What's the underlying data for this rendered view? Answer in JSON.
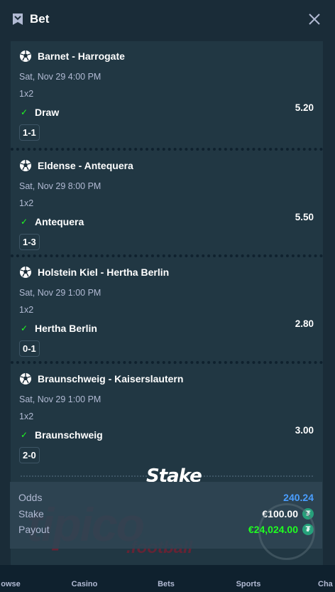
{
  "header": {
    "title": "Bet",
    "icon": "bet-slip-icon",
    "close_icon": "close-icon"
  },
  "legs": [
    {
      "match": "Barnet - Harrogate",
      "time": "Sat, Nov 29  4:00 PM",
      "market": "1x2",
      "pick": "Draw",
      "odds": "5.20",
      "score": "1-1"
    },
    {
      "match": "Eldense - Antequera",
      "time": "Sat, Nov 29  8:00 PM",
      "market": "1x2",
      "pick": "Antequera",
      "odds": "5.50",
      "score": "1-3"
    },
    {
      "match": "Holstein Kiel - Hertha Berlin",
      "time": "Sat, Nov 29  1:00 PM",
      "market": "1x2",
      "pick": "Hertha Berlin",
      "odds": "2.80",
      "score": "0-1"
    },
    {
      "match": "Braunschweig - Kaiserslautern",
      "time": "Sat, Nov 29  1:00 PM",
      "market": "1x2",
      "pick": "Braunschweig",
      "odds": "3.00",
      "score": "2-0"
    }
  ],
  "brand": {
    "logo": "Stake"
  },
  "summary": {
    "odds_label": "Odds",
    "odds_value": "240.24",
    "stake_label": "Stake",
    "stake_value": "€100.00",
    "payout_label": "Payout",
    "payout_value": "€24,024.00",
    "currency_icon": "tether-icon"
  },
  "watermark": {
    "text": "tipico",
    "subtext": ".football"
  },
  "nav": [
    {
      "label": "owse"
    },
    {
      "label": "Casino"
    },
    {
      "label": "Bets"
    },
    {
      "label": "Sports"
    },
    {
      "label": "Cha"
    }
  ],
  "colors": {
    "accent_blue": "#4a9eff",
    "accent_green": "#1fff20",
    "panel": "#213743",
    "bg": "#1a2c38"
  }
}
